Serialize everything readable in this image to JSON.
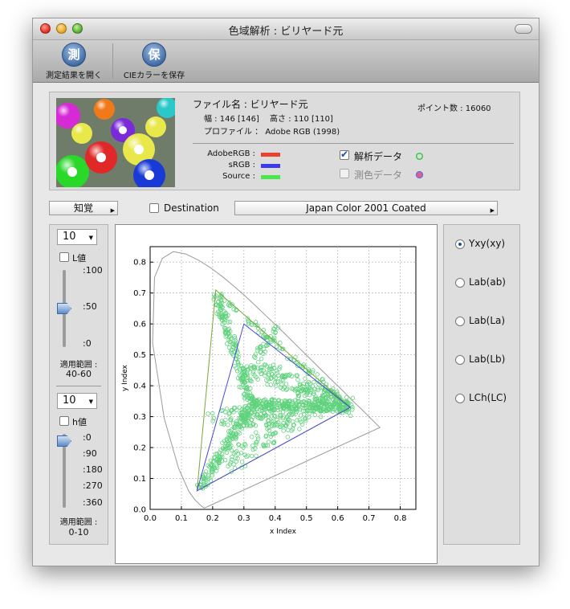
{
  "window": {
    "title": "色域解析 : ビリヤード元"
  },
  "toolbar": {
    "open": {
      "icon": "測",
      "label": "測定結果を開く"
    },
    "save": {
      "icon": "保",
      "label": "CIEカラーを保存"
    }
  },
  "info": {
    "filename": "ファイル名 : ビリヤード元",
    "dims": "幅 : 146 [146]　 高さ : 110 [110]",
    "profile": "プロファイル ： Adobe RGB (1998)",
    "points": "ポイント数 : 16060",
    "legend": [
      {
        "label": "AdobeRGB :",
        "color": "#e8432e"
      },
      {
        "label": "sRGB :",
        "color": "#3a3aef"
      },
      {
        "label": "Source :",
        "color": "#4be84b"
      }
    ],
    "analysis_label": "解析データ",
    "analysis_checked": true,
    "measure_label": "測色データ",
    "measure_checked": false
  },
  "controls": {
    "intent": "知覚",
    "destination_label": "Destination",
    "destination_checked": false,
    "profile_select": "Japan Color 2001 Coated"
  },
  "l_panel": {
    "step": "10",
    "checkbox_label": "L値",
    "ticks": [
      ":100",
      ":50",
      ":0"
    ],
    "slider_value": 50,
    "range_label": "適用範囲 :",
    "range_value": "40-60"
  },
  "h_panel": {
    "step": "10",
    "checkbox_label": "h値",
    "ticks": [
      ":0",
      ":90",
      ":180",
      ":270",
      ":360"
    ],
    "slider_value": 0,
    "range_label": "適用範囲 :",
    "range_value": "0-10"
  },
  "modes": [
    {
      "label": "Yxy(xy)",
      "selected": true
    },
    {
      "label": "Lab(ab)",
      "selected": false
    },
    {
      "label": "Lab(La)",
      "selected": false
    },
    {
      "label": "Lab(Lb)",
      "selected": false
    },
    {
      "label": "LCh(LC)",
      "selected": false
    }
  ],
  "chart_data": {
    "type": "scatter",
    "xlabel": "x Index",
    "ylabel": "y Index",
    "xlim": [
      0,
      0.85
    ],
    "ylim": [
      0,
      0.85
    ],
    "xticks": [
      "0.0",
      "0.1",
      "0.2",
      "0.3",
      "0.4",
      "0.5",
      "0.6",
      "0.7",
      "0.8"
    ],
    "yticks": [
      "0.0",
      "0.1",
      "0.2",
      "0.3",
      "0.4",
      "0.5",
      "0.6",
      "0.7",
      "0.8"
    ],
    "grid": true,
    "gamut_adobe": [
      [
        0.64,
        0.33
      ],
      [
        0.21,
        0.71
      ],
      [
        0.15,
        0.06
      ]
    ],
    "gamut_srgb": [
      [
        0.64,
        0.33
      ],
      [
        0.3,
        0.6
      ],
      [
        0.15,
        0.06
      ]
    ],
    "spectral_locus": [
      [
        0.175,
        0.005
      ],
      [
        0.172,
        0.005
      ],
      [
        0.166,
        0.009
      ],
      [
        0.144,
        0.03
      ],
      [
        0.124,
        0.058
      ],
      [
        0.091,
        0.133
      ],
      [
        0.045,
        0.295
      ],
      [
        0.008,
        0.538
      ],
      [
        0.014,
        0.75
      ],
      [
        0.039,
        0.812
      ],
      [
        0.074,
        0.834
      ],
      [
        0.115,
        0.826
      ],
      [
        0.155,
        0.806
      ],
      [
        0.193,
        0.782
      ],
      [
        0.23,
        0.754
      ],
      [
        0.266,
        0.724
      ],
      [
        0.302,
        0.692
      ],
      [
        0.337,
        0.659
      ],
      [
        0.373,
        0.624
      ],
      [
        0.409,
        0.59
      ],
      [
        0.444,
        0.555
      ],
      [
        0.479,
        0.52
      ],
      [
        0.512,
        0.487
      ],
      [
        0.545,
        0.454
      ],
      [
        0.575,
        0.424
      ],
      [
        0.603,
        0.397
      ],
      [
        0.627,
        0.373
      ],
      [
        0.648,
        0.351
      ],
      [
        0.666,
        0.334
      ],
      [
        0.681,
        0.319
      ],
      [
        0.735,
        0.265
      ]
    ],
    "scatter_color": "#5fd27c",
    "clusters": [
      {
        "from": [
          0.64,
          0.33
        ],
        "to": [
          0.325,
          0.34
        ],
        "n": 260,
        "spread": 0.018
      },
      {
        "from": [
          0.325,
          0.34
        ],
        "to": [
          0.21,
          0.7
        ],
        "n": 170,
        "spread": 0.014
      },
      {
        "from": [
          0.325,
          0.34
        ],
        "to": [
          0.16,
          0.07
        ],
        "n": 170,
        "spread": 0.014
      },
      {
        "from": [
          0.35,
          0.45
        ],
        "to": [
          0.64,
          0.33
        ],
        "n": 200,
        "spread": 0.028
      },
      {
        "from": [
          0.21,
          0.7
        ],
        "to": [
          0.64,
          0.33
        ],
        "n": 90,
        "spread": 0.01
      },
      {
        "from": [
          0.2,
          0.3
        ],
        "to": [
          0.45,
          0.3
        ],
        "n": 120,
        "spread": 0.03
      },
      {
        "from": [
          0.25,
          0.15
        ],
        "to": [
          0.55,
          0.34
        ],
        "n": 110,
        "spread": 0.03
      },
      {
        "from": [
          0.29,
          0.4
        ],
        "to": [
          0.4,
          0.58
        ],
        "n": 60,
        "spread": 0.02
      }
    ]
  }
}
